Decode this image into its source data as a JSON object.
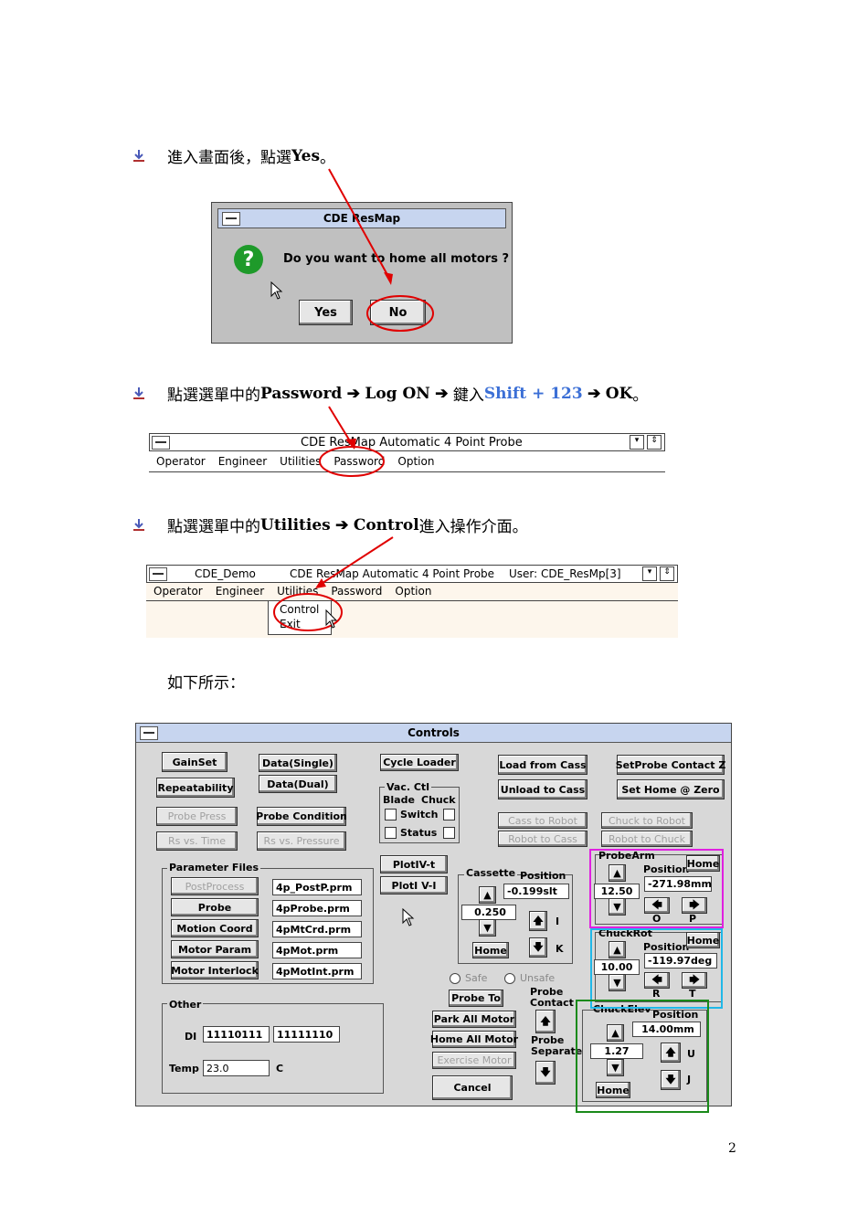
{
  "step1": {
    "text": "進入畫面後，點選 ",
    "bold": "Yes",
    "end": "。"
  },
  "step2": {
    "pre": "點選選單中的 ",
    "b1": "Password",
    "arrow1": "➔",
    "b2": "Log ON",
    "arrow2": "➔",
    "mid": "鍵入 ",
    "blue": "Shift + 123",
    "arrow3": "➔",
    "b3": "OK",
    "end": "。"
  },
  "step3": {
    "pre": "點選選單中的 ",
    "b1": "Utilities",
    "arrow1": "➔",
    "b2": "Control",
    "end": " 進入操作介面。"
  },
  "caption": "如下所示：",
  "page_number": "2",
  "dialog1": {
    "title": "CDE ResMap",
    "message": "Do you want to home all motors ?",
    "yes": "Yes",
    "no": "No"
  },
  "menubar1": {
    "title": "CDE ResMap Automatic 4 Point Probe",
    "items": [
      "Operator",
      "Engineer",
      "Utilities",
      "Password",
      "Option"
    ]
  },
  "menubar2": {
    "left": "CDE_Demo",
    "title": "CDE ResMap Automatic 4 Point Probe",
    "user": "User: CDE_ResMp[3]",
    "items": [
      "Operator",
      "Engineer",
      "Utilities",
      "Password",
      "Option"
    ],
    "dropdown": [
      "Control",
      "Exit"
    ]
  },
  "controls": {
    "title": "Controls",
    "gainset": "GainSet",
    "data_single": "Data(Single)",
    "cycle_loader": "Cycle Loader",
    "load_from_cass": "Load from Cass",
    "setprobe_contact": "SetProbe Contact Z",
    "repeatability": "Repeatability",
    "data_dual": "Data(Dual)",
    "unload_to_cass": "Unload to Cass",
    "set_home_zero": "Set Home @ Zero",
    "vac_ctl": "Vac. Ctl",
    "blade": "Blade",
    "chuck": "Chuck",
    "switch": "Switch",
    "status": "Status",
    "probe_press": "Probe Press",
    "probe_condition": "Probe Condition",
    "cass_to_robot": "Cass to Robot",
    "chuck_to_robot": "Chuck to Robot",
    "rs_vs_time": "Rs vs. Time",
    "rs_vs_pressure": "Rs vs. Pressure",
    "robot_to_cass": "Robot to Cass",
    "robot_to_chuck": "Robot to Chuck",
    "parameter_files": "Parameter Files",
    "params": [
      {
        "button": "PostProcess",
        "file": "4p_PostP.prm",
        "disabled": true
      },
      {
        "button": "Probe",
        "file": "4pProbe.prm",
        "disabled": false
      },
      {
        "button": "Motion Coord",
        "file": "4pMtCrd.prm",
        "disabled": false
      },
      {
        "button": "Motor Param",
        "file": "4pMot.prm",
        "disabled": false
      },
      {
        "button": "Motor Interlock",
        "file": "4pMotInt.prm",
        "disabled": false
      }
    ],
    "plot_iv_t": "PlotIV-t",
    "plot_v_i": "PlotI V-I",
    "cassette": "Cassette",
    "position": "Position",
    "cass_pos": "-0.199slt",
    "cass_step": "0.250",
    "home": "Home",
    "I": "I",
    "K": "K",
    "probearm": "ProbeArm",
    "probearm_step": "12.50",
    "probearm_pos": "-271.98mm",
    "O": "O",
    "P": "P",
    "chuckrot": "ChuckRot",
    "chuckrot_step": "10.00",
    "chuckrot_pos": "-119.97deg",
    "R": "R",
    "T": "T",
    "chuckelev": "ChuckElev",
    "chuckelev_step": "1.27",
    "chuckelev_pos": "14.00mm",
    "U": "U",
    "J": "J",
    "safe": "Safe",
    "unsafe": "Unsafe",
    "probe_to": "Probe To",
    "probe_contact": "Probe Contact",
    "probe_separate": "Probe Separate",
    "park_all_motor": "Park All Motor",
    "home_all_motor": "Home All Motor",
    "exercise_motor": "Exercise Motor",
    "cancel": "Cancel",
    "other": "Other",
    "di": "DI",
    "di1": "11110111",
    "di2": "11111110",
    "temp": "Temp",
    "temp_val": "23.0",
    "c": "C"
  }
}
